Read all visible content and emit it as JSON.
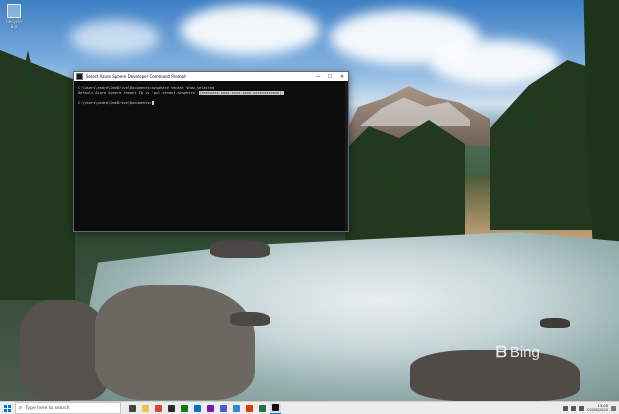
{
  "desktop": {
    "icon_label": "Recycle Bin"
  },
  "window": {
    "title": "Select Azure Sphere Developer Command Prompt",
    "controls": {
      "minimize": "—",
      "maximize": "☐",
      "close": "✕"
    },
    "lines": {
      "l1": "C:\\Users\\andre\\OneDrive\\Documents>azsphere tenant show-selected",
      "l2_prefix": "Default Azure Sphere tenant ID is 'avl.tenant.azsphere' ",
      "l2_selected": "(xxxxxxxx-xxxx-xxxx-xxxx-xxxxxxxxxxxx).",
      "l3": "C:\\Users\\andre\\OneDrive\\Documents>"
    }
  },
  "wallpaper_brand": {
    "mark": "ᗷ",
    "word": "Bing"
  },
  "taskbar": {
    "search_placeholder": "Type here to search",
    "apps": [
      {
        "name": "task-view-icon",
        "color": "#444444"
      },
      {
        "name": "file-explorer-icon",
        "color": "#f2c14e"
      },
      {
        "name": "chrome-icon",
        "color": "#db4437"
      },
      {
        "name": "store-icon",
        "color": "#2b2b2b"
      },
      {
        "name": "xbox-icon",
        "color": "#107c10"
      },
      {
        "name": "outlook-icon",
        "color": "#0072c6"
      },
      {
        "name": "onenote-icon",
        "color": "#7719aa"
      },
      {
        "name": "teams-icon",
        "color": "#5059c9"
      },
      {
        "name": "vscode-icon",
        "color": "#2a8ad4"
      },
      {
        "name": "office-icon",
        "color": "#d83b01"
      },
      {
        "name": "excel-icon",
        "color": "#217346"
      },
      {
        "name": "terminal-icon",
        "color": "#0c0c0c"
      }
    ],
    "clock_time": "13:05",
    "clock_date": "02/06/2020"
  }
}
